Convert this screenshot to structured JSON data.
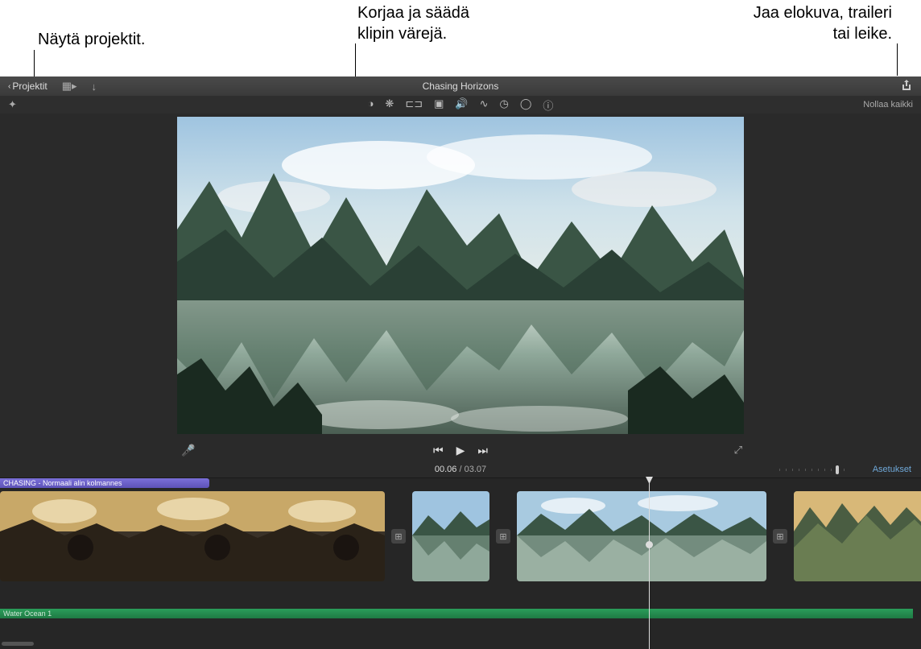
{
  "annotations": {
    "left": "Näytä projektit.",
    "center": "Korjaa ja säädä\nklipin värejä.",
    "right": "Jaa elokuva, traileri\ntai leike."
  },
  "toolbar": {
    "projects_label": "Projektit",
    "title": "Chasing Horizons"
  },
  "adjust": {
    "reset_label": "Nollaa kaikki"
  },
  "playback": {
    "current_time": "00.06",
    "duration": "03.07",
    "settings_label": "Asetukset"
  },
  "timeline": {
    "title_clip_label": "CHASING - Normaali alin kolmannes",
    "audio_clip_label": "Water Ocean 1"
  }
}
